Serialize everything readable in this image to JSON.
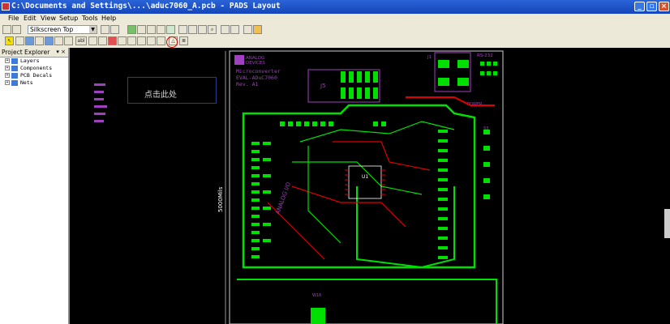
{
  "window": {
    "title": "C:\\Documents and Settings\\...\\aduc7060_A.pcb - PADS Layout"
  },
  "menu": {
    "items": [
      "File",
      "Edit",
      "View",
      "Setup",
      "Tools",
      "Help"
    ]
  },
  "toolbar": {
    "layer_value": "Silkscreen Top",
    "toolbar_label": "abl"
  },
  "explorer": {
    "title": "Project Explorer",
    "items": [
      "Layers",
      "Components",
      "PCB Decals",
      "Nets"
    ]
  },
  "board": {
    "logo_text_1": "ANALOG",
    "logo_text_2": "DEVICES",
    "product_line1": "Microconverter",
    "product_line2": "EVAL-ADuC7060",
    "product_line3": "Rev. A1",
    "dimension": "5000Mils",
    "ref_j5": "J5",
    "ref_j1": "J1",
    "ref_rs232": "RS-232",
    "vertical_label": "ANALOG I/O",
    "ref_u1": "U1",
    "ref_s3": "S3",
    "ref_w16": "W16",
    "power_label": "POWER"
  },
  "annotation": {
    "text": "点击此处"
  },
  "colors": {
    "trace_green": "#00e000",
    "trace_red": "#e00000",
    "silk_purple": "#a040c0",
    "silk_white": "#ffffff"
  }
}
